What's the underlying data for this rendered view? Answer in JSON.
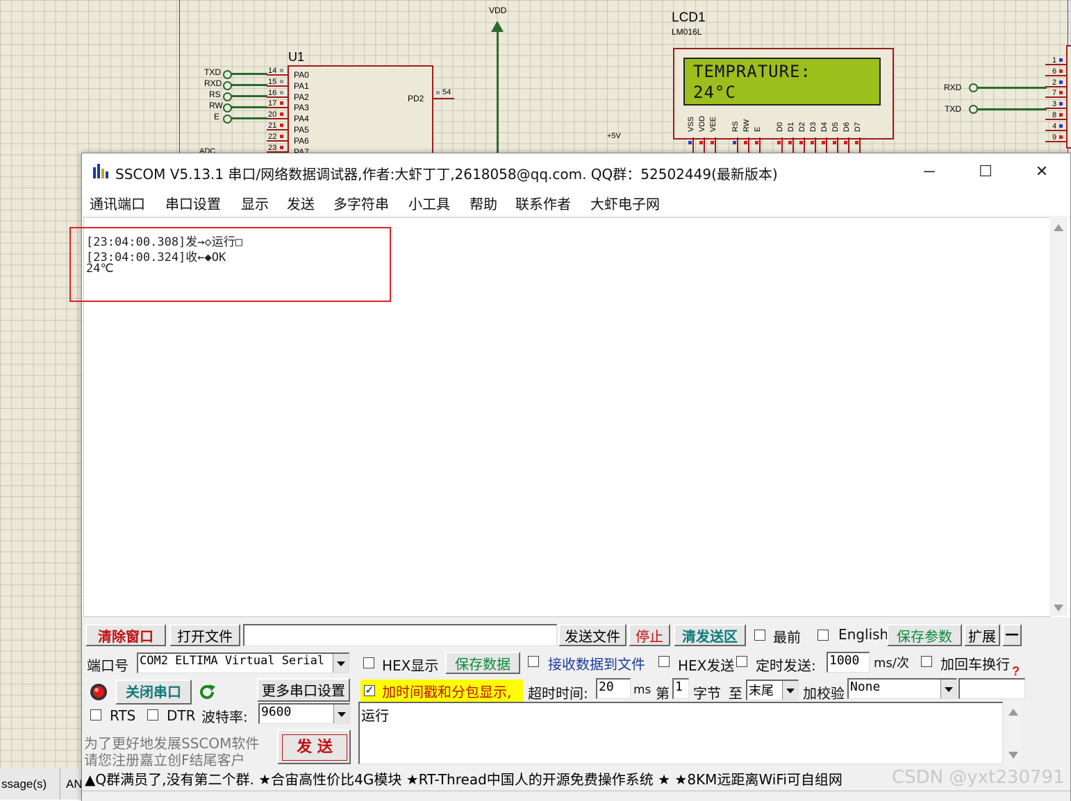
{
  "schematic": {
    "vdd_label": "VDD",
    "plus5v_label": "+5V",
    "u1": {
      "name": "U1",
      "pins_left": [
        {
          "num": "14",
          "name": "PA0",
          "net": ""
        },
        {
          "num": "15",
          "name": "PA1",
          "net": ""
        },
        {
          "num": "16",
          "name": "PA2",
          "net": ""
        },
        {
          "num": "17",
          "name": "PA3",
          "net": "TXD"
        },
        {
          "num": "20",
          "name": "PA4",
          "net": "RXD"
        },
        {
          "num": "21",
          "name": "PA5",
          "net": "RS"
        },
        {
          "num": "22",
          "name": "PA6",
          "net": "RW"
        },
        {
          "num": "23",
          "name": "PA7",
          "net": "E"
        }
      ],
      "pd2_label": "PD2",
      "pd2_num": "54",
      "partial_net": "ADC"
    },
    "lcd": {
      "name": "LCD1",
      "model": "LM016L",
      "line1": "TEMPRATURE:",
      "line2": "24°C",
      "pins": [
        "VSS",
        "VDD",
        "VEE",
        "RS",
        "RW",
        "E",
        "D0",
        "D1",
        "D2",
        "D3",
        "D4",
        "D5",
        "D6",
        "D7"
      ]
    },
    "right_conn": {
      "rxd_label": "RXD",
      "txd_label": "TXD",
      "pins": [
        "1",
        "6",
        "2",
        "7",
        "3",
        "8",
        "4",
        "9"
      ]
    }
  },
  "sscom": {
    "title": "SSCOM V5.13.1 串口/网络数据调试器,作者:大虾丁丁,2618058@qq.com. QQ群：52502449(最新版本)",
    "controls": {
      "minimize": "─",
      "maximize": "☐",
      "close": "✕"
    },
    "menu": [
      "通讯端口",
      "串口设置",
      "显示",
      "发送",
      "多字符串",
      "小工具",
      "帮助",
      "联系作者",
      "大虾电子网"
    ],
    "receive_lines": [
      "[23:04:00.308]发→◇运行□",
      "[23:04:00.324]收←◆OK",
      "24℃"
    ],
    "row1": {
      "clear_btn": "清除窗口",
      "open_file_btn": "打开文件",
      "file_path": "",
      "send_file_btn": "发送文件",
      "stop_btn": "停止",
      "clear_send_btn": "清发送区",
      "topmost_label": "最前",
      "english_label": "English",
      "save_params_btn": "保存参数",
      "expand_btn": "扩展",
      "collapse_btn": "—"
    },
    "port": {
      "port_label": "端口号",
      "port_value": "COM2 ELTIMA Virtual Serial",
      "close_port_btn": "关闭串口",
      "more_settings_btn": "更多串口设置",
      "rts_label": "RTS",
      "dtr_label": "DTR",
      "baud_label": "波特率:",
      "baud_value": "9600",
      "promo_line1": "为了更好地发展SSCOM软件",
      "promo_line2": "请您注册嘉立创F结尾客户",
      "send_btn": "发  送"
    },
    "options": {
      "hex_display": "HEX显示",
      "save_data_btn": "保存数据",
      "recv_to_file": "接收数据到文件",
      "hex_send": "HEX发送",
      "timed_send": "定时发送:",
      "interval_value": "1000",
      "interval_unit": "ms/次",
      "add_crlf": "加回车换行",
      "timestamp_label": "加时间戳和分包显示,",
      "timeout_label": "超时时间:",
      "timeout_value": "20",
      "timeout_unit": "ms",
      "byte_from_label": "第",
      "byte_from_value": "1",
      "byte_unit": "字节",
      "to_label": "至",
      "to_value": "末尾",
      "checksum_label": "加校验",
      "checksum_value": "None",
      "help_icon": "?"
    },
    "send_text": "运行",
    "ticker": "▲Q群满员了,没有第二个群. ★合宙高性价比4G模块 ★RT-Thread中国人的开源免费操作系统 ★ ★8KM远距离WiFi可自组网",
    "watermark": "CSDN @yxt230791"
  },
  "background_tabs": {
    "messages": "ssage(s)",
    "an": "AN"
  }
}
